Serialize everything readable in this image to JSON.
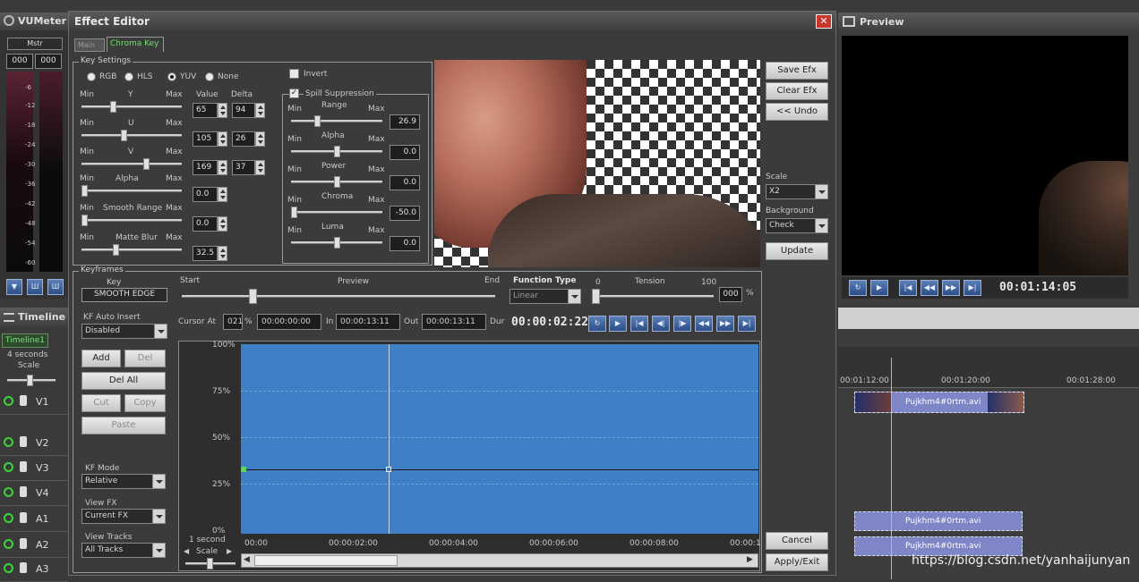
{
  "vumeter": {
    "title": "VUMeter",
    "mstr": "Mstr",
    "readouts": [
      "000",
      "000"
    ],
    "scale": [
      "0",
      "-6",
      "-12",
      "-18",
      "-24",
      "-30",
      "-36",
      "-42",
      "-48",
      "-54",
      "-60"
    ]
  },
  "timeline": {
    "title": "Timeline",
    "tab": "Timeline1",
    "zoom": "4 seconds",
    "scale_label": "Scale",
    "tracks": [
      "V1",
      "V2",
      "V3",
      "V4",
      "A1",
      "A2",
      "A3"
    ],
    "ruler": [
      "00:01:12:00",
      "00:01:20:00",
      "00:01:28:00"
    ],
    "clips": [
      {
        "track": "V1",
        "label": "Pujkhm4#0rtm.avi"
      },
      {
        "track": "A1",
        "label": "Pujkhm4#0rtm.avi"
      },
      {
        "track": "A2",
        "label": "Pujkhm4#0rtm.avi"
      }
    ]
  },
  "preview": {
    "title": "Preview",
    "timecode": "00:01:14:05"
  },
  "editor": {
    "title": "Effect Editor",
    "close": "✕",
    "tabs": [
      "Main",
      "Chroma Key"
    ],
    "key_settings": {
      "legend": "Key Settings",
      "modes": [
        "RGB",
        "HLS",
        "YUV",
        "None"
      ],
      "selected_mode": "YUV",
      "min": "Min",
      "max": "Max",
      "value_label": "Value",
      "delta_label": "Delta",
      "channels": [
        {
          "name": "Y",
          "value": "65",
          "delta": "94",
          "pos": 0.3
        },
        {
          "name": "U",
          "value": "105",
          "delta": "26",
          "pos": 0.42
        },
        {
          "name": "V",
          "value": "169",
          "delta": "37",
          "pos": 0.66
        }
      ],
      "alpha": {
        "label": "Alpha",
        "value": "0.0",
        "pos": 0.0
      },
      "smooth": {
        "label": "Smooth Range",
        "value": "0.0",
        "pos": 0.0
      },
      "matte": {
        "label": "Matte Blur",
        "value": "32.5",
        "pos": 0.33
      }
    },
    "invert": {
      "label": "Invert",
      "checked": false
    },
    "spill": {
      "legend": "Spill Suppression",
      "checked": true,
      "min": "Min",
      "max": "Max",
      "rows": [
        {
          "label": "Range",
          "value": "26.9",
          "pos": 0.27
        },
        {
          "label": "Alpha",
          "value": "0.0",
          "pos": 0.5
        },
        {
          "label": "Power",
          "value": "0.0",
          "pos": 0.5
        },
        {
          "label": "Chroma",
          "value": "-50.0",
          "pos": 0.0
        },
        {
          "label": "Luma",
          "value": "0.0",
          "pos": 0.5
        }
      ]
    },
    "buttons": {
      "save": "Save Efx",
      "clear": "Clear Efx",
      "undo": "<< Undo",
      "update": "Update",
      "cancel": "Cancel",
      "apply": "Apply/Exit"
    },
    "scale": {
      "label": "Scale",
      "value": "X2"
    },
    "background": {
      "label": "Background",
      "value": "Check"
    },
    "keyframes": {
      "legend": "Keyframes",
      "key_label": "Key",
      "key_value": "SMOOTH EDGE",
      "start": "Start",
      "preview": "Preview",
      "end": "End",
      "start_pos": 0.22,
      "function_type_label": "Function Type",
      "function_type": "Linear",
      "tension_min": "0",
      "tension_label": "Tension",
      "tension_max": "100",
      "tension_value": "000",
      "pct": "%",
      "auto_insert_label": "KF Auto Insert",
      "auto_insert": "Disabled",
      "cursor_label": "Cursor At",
      "cursor_pct": "021",
      "cursor_tc": "00:00:00:00",
      "in_label": "In",
      "in_tc": "00:00:13:11",
      "out_label": "Out",
      "out_tc": "00:00:13:11",
      "dur_label": "Dur",
      "dur_tc": "00:00:02:22",
      "add": "Add",
      "del": "Del",
      "del_all": "Del All",
      "cut": "Cut",
      "copy": "Copy",
      "paste": "Paste",
      "kf_mode_label": "KF Mode",
      "kf_mode": "Relative",
      "view_fx_label": "View FX",
      "view_fx": "Current FX",
      "view_tracks_label": "View Tracks",
      "view_tracks": "All Tracks",
      "graph_zoom": "1 second",
      "graph_scale": "Scale",
      "y_ticks": [
        "100%",
        "75%",
        "50%",
        "25%",
        "0%"
      ],
      "x_ticks": [
        "00:00",
        "00:00:02:00",
        "00:00:04:00",
        "00:00:06:00",
        "00:00:08:00",
        "00:00:1"
      ]
    }
  },
  "watermark": "https://blog.csdn.net/yanhaijunyan"
}
